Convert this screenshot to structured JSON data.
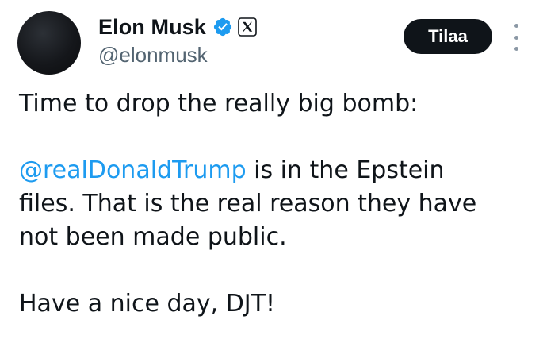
{
  "author": {
    "display_name": "Elon Musk",
    "handle": "@elonmusk",
    "verified_icon": "verified-badge-icon",
    "affiliation_icon": "x-logo-icon"
  },
  "actions": {
    "subscribe_label": "Tilaa",
    "more_icon": "more-vertical-icon"
  },
  "tweet": {
    "line1": "Time to drop the really big bomb:",
    "mention": "@realDonaldTrump",
    "line2_rest": " is in the Epstein",
    "line3": "files. That is the real reason they have",
    "line4": "not been made public.",
    "line5": "Have a nice day, DJT!"
  },
  "colors": {
    "text": "#0f1419",
    "secondary_text": "#536471",
    "mention": "#1d9bf0",
    "verified": "#1d9bf0",
    "button_bg": "#0f1419",
    "button_text": "#ffffff"
  }
}
